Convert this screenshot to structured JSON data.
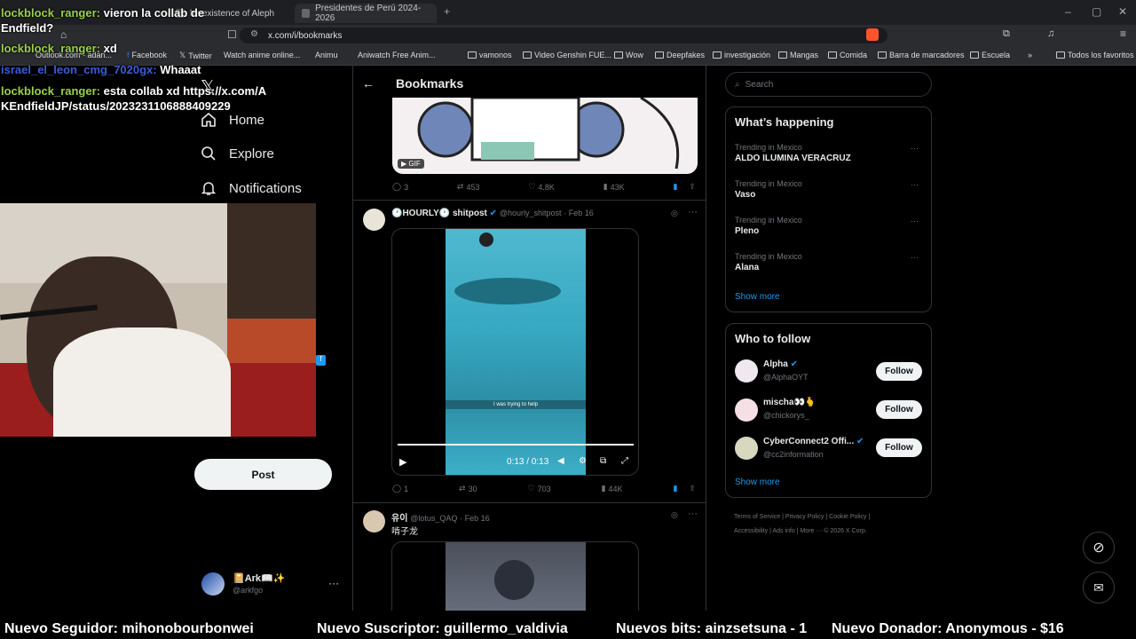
{
  "browser": {
    "tabs": [
      {
        "label": "he existence of Aleph"
      },
      {
        "label": "Presidentes de Perú 2024-2026"
      }
    ],
    "url": "x.com/i/bookmarks",
    "bookmarks": [
      "Outlook.com - adan...",
      "Facebook",
      "Twitter",
      "Watch anime online...",
      "Animu",
      "Aniwatch Free Anim...",
      "vamonos",
      "Video Genshin FUE...",
      "Wow",
      "Deepfakes",
      "investigación",
      "Mangas",
      "Comida",
      "Barra de marcadores",
      "Escuela",
      "Todos los favoritos"
    ]
  },
  "nav": {
    "home": "Home",
    "explore": "Explore",
    "notifications": "Notifications",
    "post": "Post",
    "account_name": "📔Ark📖✨",
    "account_handle": "@arkfgo"
  },
  "header": {
    "title": "Bookmarks"
  },
  "tweets": [
    {
      "gif_label": "GIF",
      "replies": "3",
      "reposts": "453",
      "likes": "4.8K",
      "views": "43K"
    },
    {
      "author": "🕐HOURLY🕐 shitpost",
      "handle": "@hourly_shitpost",
      "date": "· Feb 16",
      "caption": "I was trying to help",
      "time": "0:13 / 0:13",
      "replies": "1",
      "reposts": "30",
      "likes": "703",
      "views": "44K"
    },
    {
      "author": "유이",
      "handle": "@lotus_QAQ",
      "date": "· Feb 16",
      "text": "啃子龙"
    }
  ],
  "search": {
    "placeholder": "Search"
  },
  "trends": {
    "title": "What’s happening",
    "items": [
      {
        "context": "Trending in Mexico",
        "name": "ALDO ILUMINA VERACRUZ"
      },
      {
        "context": "Trending in Mexico",
        "name": "Vaso"
      },
      {
        "context": "Trending in Mexico",
        "name": "Pleno"
      },
      {
        "context": "Trending in Mexico",
        "name": "Alana"
      }
    ],
    "show_more": "Show more"
  },
  "who_to_follow": {
    "title": "Who to follow",
    "follow_label": "Follow",
    "users": [
      {
        "name": "Alpha",
        "handle": "@AlphaOYT"
      },
      {
        "name": "mischa👀🫰",
        "handle": "@chickorys_"
      },
      {
        "name": "CyberConnect2 Offi...",
        "handle": "@cc2information"
      }
    ],
    "show_more": "Show more"
  },
  "footer_links": [
    "Terms of Service",
    "Privacy Policy",
    "Cookie Policy",
    "Accessibility",
    "Ads info",
    "More ···",
    "© 2026 X Corp."
  ],
  "chat": [
    {
      "user": "lockblock_ranger:",
      "msg": "vieron la collab de Endfield?"
    },
    {
      "user": "lockblock_ranger:",
      "msg": "xd"
    },
    {
      "user": "israel_el_leon_cmg_7020gx:",
      "msg": "Whaaat"
    },
    {
      "user": "lockblock_ranger:",
      "msg": "esta collab xd https://x.com/AKEndfieldJP/status/2023231106888409229"
    }
  ],
  "ticker": [
    "Nuevo Seguidor: mihonobourbonwei",
    "Nuevo Suscriptor: guillermo_valdivia",
    "Nuevos bits: ainzsetsuna - 1",
    "Nuevo Donador: Anonymous - $16"
  ],
  "colors": {
    "accent": "#1d9bf0",
    "chat_user": "#9ad14a",
    "bg": "#000000"
  }
}
